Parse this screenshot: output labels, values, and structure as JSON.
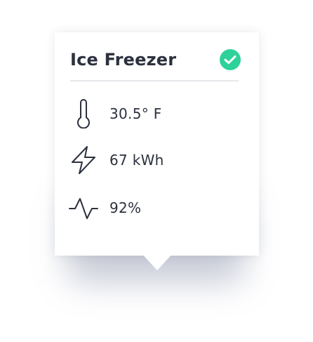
{
  "card": {
    "title": "Ice Freezer",
    "status": {
      "icon": "check-circle-icon",
      "color": "#2fd19b"
    }
  },
  "metrics": [
    {
      "icon": "thermometer-icon",
      "value": "30.5° F"
    },
    {
      "icon": "lightning-icon",
      "value": "67 kWh"
    },
    {
      "icon": "activity-pulse-icon",
      "value": "92%"
    }
  ],
  "colors": {
    "text": "#2c313e",
    "divider": "#e7e8ec",
    "accent": "#2fd19b"
  }
}
